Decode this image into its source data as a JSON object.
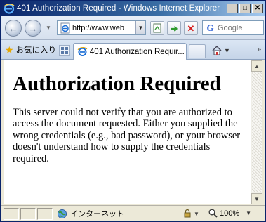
{
  "window": {
    "title": "401 Authorization Required - Windows Internet Explorer",
    "minimize": "_",
    "maximize": "□",
    "close": "✕"
  },
  "nav": {
    "back_glyph": "←",
    "forward_glyph": "→",
    "address_value": "http://www.web",
    "search_placeholder": "Google"
  },
  "commandbar": {
    "favorites_label": "お気に入り",
    "tab_label": "401 Authorization Requir..."
  },
  "page": {
    "heading": "Authorization Required",
    "body": "This server could not verify that you are authorized to access the document requested. Either you supplied the wrong credentials (e.g., bad password), or your browser doesn't understand how to supply the credentials required."
  },
  "status": {
    "zone_label": "インターネット",
    "zoom": "100%"
  },
  "icons": {
    "ie": "ie-logo-icon",
    "search_provider": "G"
  },
  "colors": {
    "titlebar_start": "#0a246a",
    "titlebar_end": "#a6caf0",
    "ie_blue": "#1d6fd6"
  }
}
